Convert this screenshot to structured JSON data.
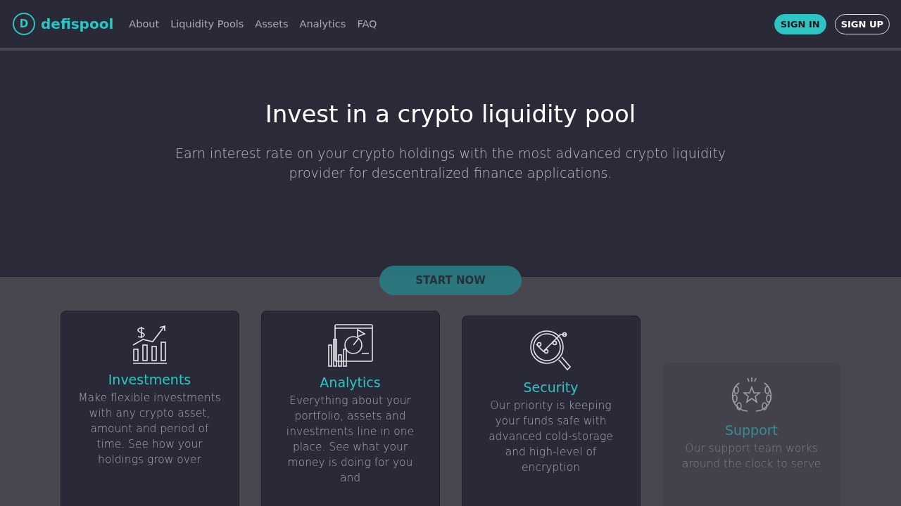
{
  "header": {
    "logo_letter": "D",
    "brand": "defispool",
    "nav": [
      {
        "label": "About"
      },
      {
        "label": "Liquidity Pools"
      },
      {
        "label": "Assets"
      },
      {
        "label": "Analytics"
      },
      {
        "label": "FAQ"
      }
    ],
    "buttons": [
      {
        "label": "SIGN IN",
        "kind": "filled"
      },
      {
        "label": "SIGN UP",
        "kind": "outline"
      }
    ]
  },
  "hero": {
    "title": "Invest in a crypto liquidity pool",
    "subtitle": "Earn interest rate on your crypto holdings with the most advanced crypto liquidity provider for descentralized finance applications.",
    "cta": "START NOW"
  },
  "features": [
    {
      "kind": "growth",
      "title": "Investments",
      "text": "Make flexible investments with any crypto asset, amount and period of time. See how your holdings grow over",
      "dimmed": false
    },
    {
      "kind": "chart",
      "title": "Analytics",
      "text": "Everything about your portfolio, assets and investments line in one place. See what your money is doing for you and",
      "dimmed": false
    },
    {
      "kind": "search",
      "title": "Security",
      "text": "Our priority is keeping your funds safe with advanced cold-storage and high-level of encryption",
      "dimmed": false
    },
    {
      "kind": "award",
      "title": "Support",
      "text": "Our support team works around the clock to serve",
      "dimmed": true
    }
  ]
}
